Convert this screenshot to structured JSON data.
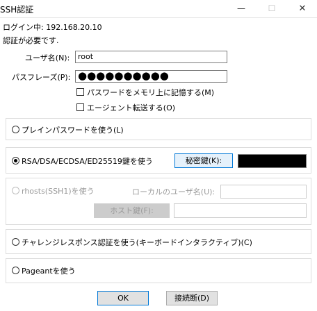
{
  "window": {
    "title": "SSH認証",
    "minimize_glyph": "—",
    "maximize_glyph": "☐",
    "close_glyph": "✕"
  },
  "status": {
    "login_line": "ログイン中: 192.168.20.10",
    "auth_required": "認証が必要です."
  },
  "form": {
    "username_label": "ユーザ名(N):",
    "username_value": "root",
    "passphrase_label": "パスフレーズ(P):",
    "passphrase_mask": "●●●●●●●●●●",
    "remember_password_label": "パスワードをメモリ上に記憶する(M)",
    "agent_forward_label": "エージェント転送する(O)"
  },
  "auth_methods": {
    "plain_password": "プレインパスワードを使う(L)",
    "rsa_key": "RSA/DSA/ECDSA/ED25519鍵を使う",
    "private_key_button": "秘密鍵(K):",
    "rhosts": "rhosts(SSH1)を使う",
    "local_user_label": "ローカルのユーザ名(U):",
    "host_key_button": "ホスト鍵(F):",
    "challenge_response": "チャレンジレスポンス認証を使う(キーボードインタラクティブ)(C)",
    "pageant": "Pageantを使う"
  },
  "footer": {
    "ok": "OK",
    "disconnect": "接続断(D)"
  },
  "selected_method": "rsa_key"
}
